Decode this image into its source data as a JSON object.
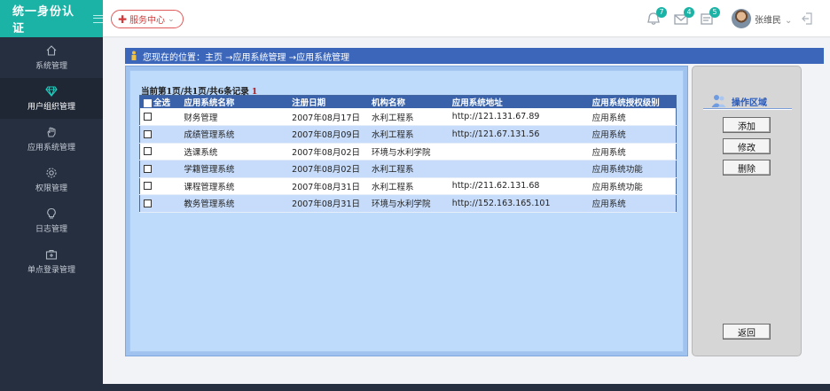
{
  "app": {
    "title": "统一身份认证"
  },
  "header": {
    "service_button": "服务中心",
    "notifications": [
      {
        "icon": "bell-icon",
        "count": "7"
      },
      {
        "icon": "mail-icon",
        "count": "4"
      },
      {
        "icon": "task-icon",
        "count": "5"
      }
    ],
    "user_name": "张维民"
  },
  "sidebar": {
    "items": [
      {
        "label": "系统管理",
        "icon": "home-icon"
      },
      {
        "label": "用户组织管理",
        "icon": "diamond-icon",
        "active": true
      },
      {
        "label": "应用系统管理",
        "icon": "hand-icon"
      },
      {
        "label": "权限管理",
        "icon": "gear-icon"
      },
      {
        "label": "日志管理",
        "icon": "bulb-icon"
      },
      {
        "label": "单点登录管理",
        "icon": "medkit-icon"
      }
    ]
  },
  "breadcrumb": {
    "text": "您现在的位置：主页 →应用系统管理 →应用系统管理"
  },
  "grid": {
    "caption": "当前第1页/共1页/共6条记录",
    "caption_mark": "1",
    "headers": [
      "全选",
      "应用系统名称",
      "注册日期",
      "机构名称",
      "应用系统地址",
      "应用系统授权级别"
    ],
    "rows": [
      {
        "name": "财务管理",
        "date": "2007年08月17日",
        "org": "水利工程系",
        "url": "http://121.131.67.89",
        "level": "应用系统"
      },
      {
        "name": "成绩管理系统",
        "date": "2007年08月09日",
        "org": "水利工程系",
        "url": "http://121.67.131.56",
        "level": "应用系统"
      },
      {
        "name": "选课系统",
        "date": "2007年08月02日",
        "org": "环境与水利学院",
        "url": "",
        "level": "应用系统"
      },
      {
        "name": "学籍管理系统",
        "date": "2007年08月02日",
        "org": "水利工程系",
        "url": "",
        "level": "应用系统功能"
      },
      {
        "name": "课程管理系统",
        "date": "2007年08月31日",
        "org": "水利工程系",
        "url": "http://211.62.131.68",
        "level": "应用系统功能"
      },
      {
        "name": "教务管理系统",
        "date": "2007年08月31日",
        "org": "环境与水利学院",
        "url": "http://152.163.165.101",
        "level": "应用系统"
      }
    ]
  },
  "operations": {
    "title": "操作区域",
    "add": "添加",
    "edit": "修改",
    "delete": "删除",
    "back": "返回"
  },
  "colors": {
    "brand": "#1bb3a6",
    "sidebar": "#262f3f",
    "header_bar": "#3c66b9",
    "accent_red": "#d23b3b"
  }
}
